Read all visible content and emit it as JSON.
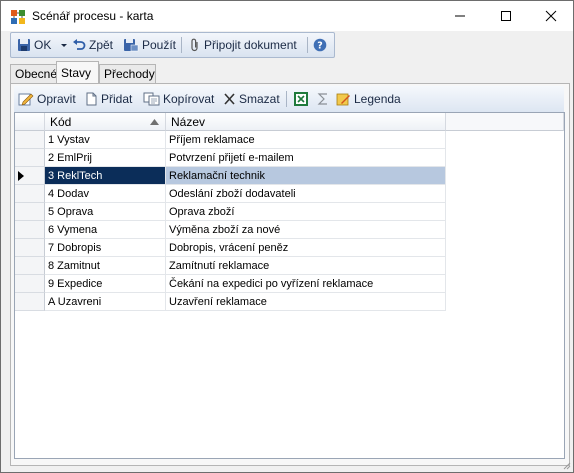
{
  "window": {
    "title": "Scénář procesu - karta"
  },
  "toolbar": {
    "ok": "OK",
    "back": "Zpět",
    "apply": "Použít",
    "attach": "Připojit dokument"
  },
  "tabs": [
    {
      "label": "Obecné"
    },
    {
      "label": "Stavy"
    },
    {
      "label": "Přechody"
    }
  ],
  "grid_toolbar": {
    "edit": "Opravit",
    "add": "Přidat",
    "copy": "Kopírovat",
    "delete": "Smazat",
    "legend": "Legenda"
  },
  "grid": {
    "columns": [
      "Kód",
      "Název"
    ],
    "rows": [
      {
        "kod": "1 Vystav",
        "nazev": "Příjem reklamace"
      },
      {
        "kod": "2 EmlPrij",
        "nazev": "Potvrzení přijetí e-mailem"
      },
      {
        "kod": "3 ReklTech",
        "nazev": "Reklamační technik"
      },
      {
        "kod": "4 Dodav",
        "nazev": "Odeslání zboží dodavateli"
      },
      {
        "kod": "5 Oprava",
        "nazev": "Oprava zboží"
      },
      {
        "kod": "6 Vymena",
        "nazev": "Výměna zboží za nové"
      },
      {
        "kod": "7 Dobropis",
        "nazev": "Dobropis, vrácení peněz"
      },
      {
        "kod": "8 Zamitnut",
        "nazev": "Zamítnutí reklamace"
      },
      {
        "kod": "9 Expedice",
        "nazev": "Čekání na expedici po vyřízení reklamace"
      },
      {
        "kod": "A Uzavreni",
        "nazev": "Uzavření reklamace"
      }
    ],
    "selected_row": "3 ReklTech"
  },
  "colors": {
    "selection_dark": "#0b2d59",
    "selection_light": "#b7c8df",
    "toolbar_text": "#1b2a45"
  }
}
